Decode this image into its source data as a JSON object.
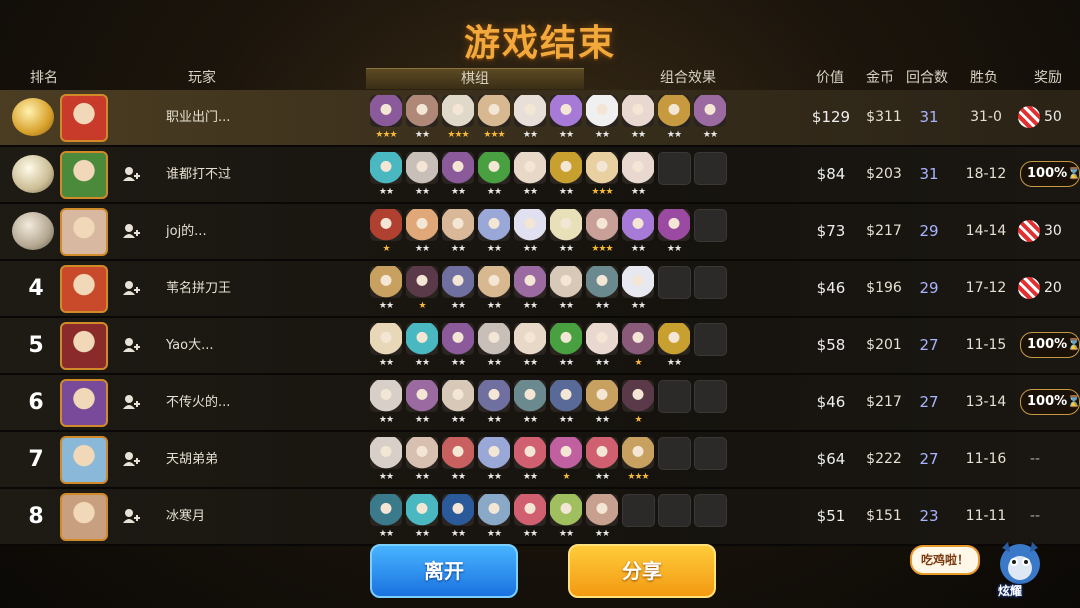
{
  "title": "游戏结束",
  "headers": {
    "rank": "排名",
    "player": "玩家",
    "pieces": "棋组",
    "combo": "组合效果",
    "value": "价值",
    "gold": "金币",
    "rounds": "回合数",
    "winloss": "胜负",
    "reward": "奖励"
  },
  "rows": [
    {
      "rank": "1",
      "name": "职业出门...",
      "value": "$129",
      "gold": "$311",
      "rounds": "31",
      "wl": "31-0",
      "reward": {
        "type": "candy",
        "amount": "50"
      },
      "pieces": [
        {
          "c": "#8a5a9a",
          "s": "★★★",
          "g": true
        },
        {
          "c": "#b08878",
          "s": "★★",
          "g": false
        },
        {
          "c": "#e0d8c8",
          "s": "★★★",
          "g": true
        },
        {
          "c": "#d8b890",
          "s": "★★★",
          "g": true
        },
        {
          "c": "#e8e0d8",
          "s": "★★",
          "g": false
        },
        {
          "c": "#a87ad8",
          "s": "★★",
          "g": false
        },
        {
          "c": "#f0f0f0",
          "s": "★★",
          "g": false
        },
        {
          "c": "#e8d8d0",
          "s": "★★",
          "g": false
        },
        {
          "c": "#c89a40",
          "s": "★★",
          "g": false
        },
        {
          "c": "#9a6aa0",
          "s": "★★",
          "g": false
        }
      ]
    },
    {
      "rank": "2",
      "name": "谁都打不过",
      "value": "$84",
      "gold": "$203",
      "rounds": "31",
      "wl": "18-12",
      "reward": {
        "type": "pct",
        "amount": "100%"
      },
      "pieces": [
        {
          "c": "#4ab8c0",
          "s": "★★",
          "g": false
        },
        {
          "c": "#c8c0b8",
          "s": "★★",
          "g": false
        },
        {
          "c": "#8a5a9a",
          "s": "★★",
          "g": false
        },
        {
          "c": "#48a040",
          "s": "★★",
          "g": false
        },
        {
          "c": "#e8d8c8",
          "s": "★★",
          "g": false
        },
        {
          "c": "#c8a030",
          "s": "★★",
          "g": false
        },
        {
          "c": "#e8d0a0",
          "s": "★★★",
          "g": true
        },
        {
          "c": "#e8d8d0",
          "s": "★★",
          "g": false
        },
        {
          "c": "",
          "s": "",
          "g": false
        },
        {
          "c": "",
          "s": "",
          "g": false
        }
      ]
    },
    {
      "rank": "3",
      "name": "joj的...",
      "value": "$73",
      "gold": "$217",
      "rounds": "29",
      "wl": "14-14",
      "reward": {
        "type": "candy",
        "amount": "30"
      },
      "pieces": [
        {
          "c": "#b04030",
          "s": "★",
          "g": true
        },
        {
          "c": "#e0a878",
          "s": "★★",
          "g": false
        },
        {
          "c": "#d8b898",
          "s": "★★",
          "g": false
        },
        {
          "c": "#9aa8d8",
          "s": "★★",
          "g": false
        },
        {
          "c": "#e0e0f0",
          "s": "★★",
          "g": false
        },
        {
          "c": "#e8e0b8",
          "s": "★★",
          "g": false
        },
        {
          "c": "#c8a098",
          "s": "★★★",
          "g": true
        },
        {
          "c": "#a87ad8",
          "s": "★★",
          "g": false
        },
        {
          "c": "#9a4aa0",
          "s": "★★",
          "g": false
        },
        {
          "c": "",
          "s": "",
          "g": false
        }
      ]
    },
    {
      "rank": "4",
      "name": "苇名拼刀王",
      "value": "$46",
      "gold": "$196",
      "rounds": "29",
      "wl": "17-12",
      "reward": {
        "type": "candy",
        "amount": "20"
      },
      "pieces": [
        {
          "c": "#c8a060",
          "s": "★★",
          "g": false
        },
        {
          "c": "#5a3a48",
          "s": "★",
          "g": true
        },
        {
          "c": "#7070a0",
          "s": "★★",
          "g": false
        },
        {
          "c": "#d8b890",
          "s": "★★",
          "g": false
        },
        {
          "c": "#9a6aa0",
          "s": "★★",
          "g": false
        },
        {
          "c": "#d8c8b8",
          "s": "★★",
          "g": false
        },
        {
          "c": "#6a8a90",
          "s": "★★",
          "g": false
        },
        {
          "c": "#e8e8f0",
          "s": "★★",
          "g": false
        },
        {
          "c": "",
          "s": "",
          "g": false
        },
        {
          "c": "",
          "s": "",
          "g": false
        }
      ]
    },
    {
      "rank": "5",
      "name": "Yao大...",
      "value": "$58",
      "gold": "$201",
      "rounds": "27",
      "wl": "11-15",
      "reward": {
        "type": "pct",
        "amount": "100%"
      },
      "pieces": [
        {
          "c": "#e8d8b8",
          "s": "★★",
          "g": false
        },
        {
          "c": "#4ab8c0",
          "s": "★★",
          "g": false
        },
        {
          "c": "#8a5a9a",
          "s": "★★",
          "g": false
        },
        {
          "c": "#c8c0b8",
          "s": "★★",
          "g": false
        },
        {
          "c": "#e8d8c8",
          "s": "★★",
          "g": false
        },
        {
          "c": "#48a040",
          "s": "★★",
          "g": false
        },
        {
          "c": "#e8d8d0",
          "s": "★★",
          "g": false
        },
        {
          "c": "#8a5a7a",
          "s": "★",
          "g": true
        },
        {
          "c": "#c8a030",
          "s": "★★",
          "g": false
        },
        {
          "c": "",
          "s": "",
          "g": false
        }
      ]
    },
    {
      "rank": "6",
      "name": "不传火的...",
      "value": "$46",
      "gold": "$217",
      "rounds": "27",
      "wl": "13-14",
      "reward": {
        "type": "pct",
        "amount": "100%"
      },
      "pieces": [
        {
          "c": "#d8d0c8",
          "s": "★★",
          "g": false
        },
        {
          "c": "#9a6aa0",
          "s": "★★",
          "g": false
        },
        {
          "c": "#d8c8b8",
          "s": "★★",
          "g": false
        },
        {
          "c": "#7070a0",
          "s": "★★",
          "g": false
        },
        {
          "c": "#6a8a90",
          "s": "★★",
          "g": false
        },
        {
          "c": "#5a6a98",
          "s": "★★",
          "g": false
        },
        {
          "c": "#c8a060",
          "s": "★★",
          "g": false
        },
        {
          "c": "#5a3a48",
          "s": "★",
          "g": true
        },
        {
          "c": "",
          "s": "",
          "g": false
        },
        {
          "c": "",
          "s": "",
          "g": false
        }
      ]
    },
    {
      "rank": "7",
      "name": "天胡弟弟",
      "value": "$64",
      "gold": "$222",
      "rounds": "27",
      "wl": "11-16",
      "reward": {
        "type": "none",
        "amount": "--"
      },
      "pieces": [
        {
          "c": "#d8d0c8",
          "s": "★★",
          "g": false
        },
        {
          "c": "#d8c0b0",
          "s": "★★",
          "g": false
        },
        {
          "c": "#c86060",
          "s": "★★",
          "g": false
        },
        {
          "c": "#9aa8d8",
          "s": "★★",
          "g": false
        },
        {
          "c": "#d06070",
          "s": "★★",
          "g": false
        },
        {
          "c": "#c060a0",
          "s": "★",
          "g": true
        },
        {
          "c": "#d06070",
          "s": "★★",
          "g": false
        },
        {
          "c": "#c8a060",
          "s": "★★★",
          "g": true
        },
        {
          "c": "",
          "s": "",
          "g": false
        },
        {
          "c": "",
          "s": "",
          "g": false
        }
      ]
    },
    {
      "rank": "8",
      "name": "冰寒月",
      "value": "$51",
      "gold": "$151",
      "rounds": "23",
      "wl": "11-11",
      "reward": {
        "type": "none",
        "amount": "--"
      },
      "pieces": [
        {
          "c": "#3a7a8a",
          "s": "★★",
          "g": false
        },
        {
          "c": "#4ab8c0",
          "s": "★★",
          "g": false
        },
        {
          "c": "#2a5a9a",
          "s": "★★",
          "g": false
        },
        {
          "c": "#8aa8c8",
          "s": "★★",
          "g": false
        },
        {
          "c": "#d06070",
          "s": "★★",
          "g": false
        },
        {
          "c": "#a0c060",
          "s": "★★",
          "g": false
        },
        {
          "c": "#c8a090",
          "s": "★★",
          "g": false
        },
        {
          "c": "",
          "s": "",
          "g": false
        },
        {
          "c": "",
          "s": "",
          "g": false
        },
        {
          "c": "",
          "s": "",
          "g": false
        }
      ]
    }
  ],
  "buttons": {
    "leave": "离开",
    "share": "分享"
  },
  "bubble": "吃鸡啦！",
  "mascot_label": "炫耀",
  "avatar_colors": [
    "#c83a2a",
    "#4a8a3a",
    "#d8b8a0",
    "#c84a2a",
    "#8a2a2a",
    "#7a4a9a",
    "#8ab8d8",
    "#c8a080"
  ]
}
